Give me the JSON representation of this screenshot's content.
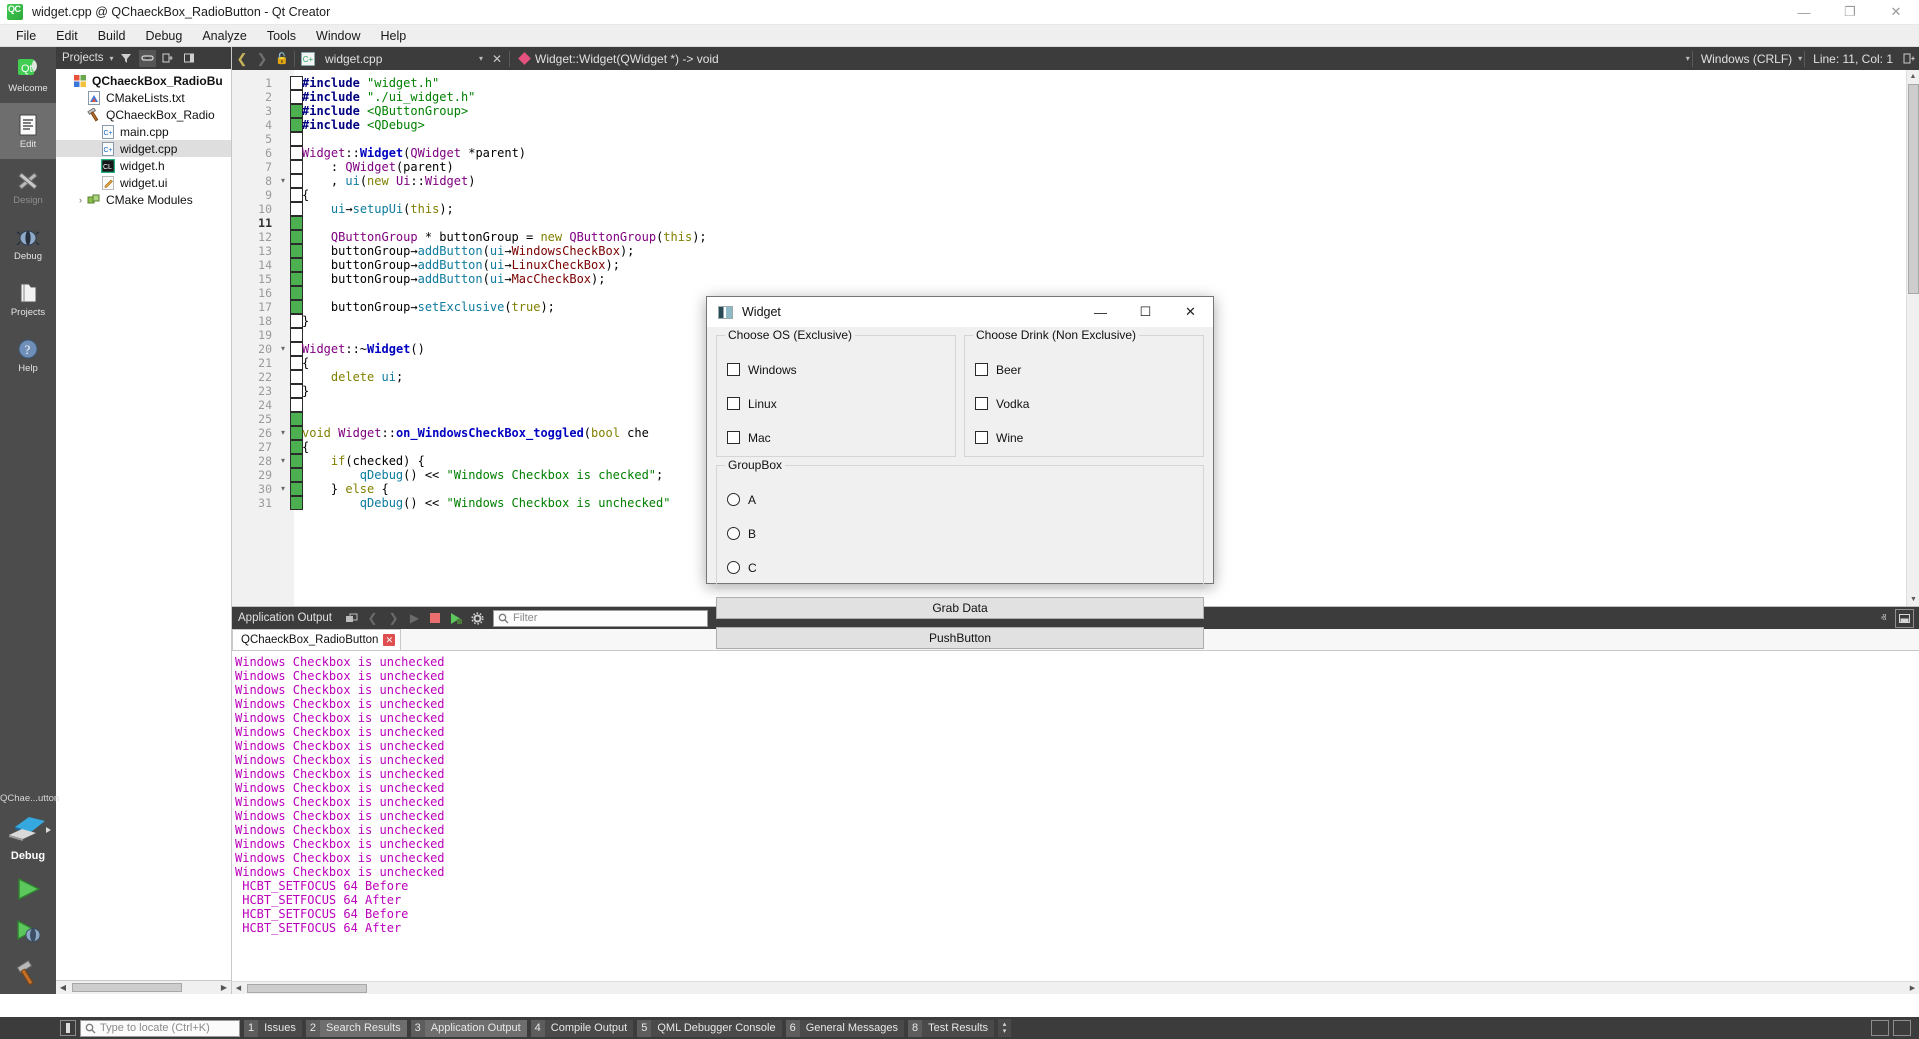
{
  "window": {
    "title": "widget.cpp @ QChaeckBox_RadioButton - Qt Creator",
    "app_icon": "qt-logo-icon",
    "minimize": "—",
    "maximize": "❐",
    "close": "✕"
  },
  "menubar": {
    "items": [
      "File",
      "Edit",
      "Build",
      "Debug",
      "Analyze",
      "Tools",
      "Window",
      "Help"
    ]
  },
  "rail": {
    "modes": [
      {
        "label": "Welcome",
        "icon": "qt-welcome-icon",
        "active": false,
        "disabled": false
      },
      {
        "label": "Edit",
        "icon": "edit-document-icon",
        "active": true,
        "disabled": false
      },
      {
        "label": "Design",
        "icon": "design-ruler-pencil-icon",
        "active": false,
        "disabled": true
      },
      {
        "label": "Debug",
        "icon": "debug-bug-icon",
        "active": false,
        "disabled": false
      },
      {
        "label": "Projects",
        "icon": "projects-folder-icon",
        "active": false,
        "disabled": false
      },
      {
        "label": "Help",
        "icon": "help-question-icon",
        "active": false,
        "disabled": false
      }
    ],
    "kit_name": "QChae...utton",
    "run_config_label": "Debug",
    "buttons": [
      "run-icon",
      "debug-run-icon",
      "build-hammer-icon"
    ]
  },
  "left_dock": {
    "header": {
      "title": "Projects",
      "dropdown_caret": "▾",
      "filter_icon": "filter-icon",
      "link_icon": "link-with-editor-icon",
      "split_icon": "split-icon",
      "close_icon": "close-dock-icon"
    },
    "tree": [
      {
        "level": 0,
        "arrow": "ⱟ",
        "icon": "project-icon",
        "label": "QChaeckBox_RadioBu",
        "bold": true,
        "selected": false
      },
      {
        "level": 1,
        "arrow": "",
        "icon": "cmake-file-icon",
        "label": "CMakeLists.txt",
        "bold": false,
        "selected": false
      },
      {
        "level": 1,
        "arrow": "ⱟ",
        "icon": "hammer-icon",
        "label": "QChaeckBox_Radio",
        "bold": false,
        "selected": false
      },
      {
        "level": 2,
        "arrow": "",
        "icon": "cpp-file-icon",
        "label": "main.cpp",
        "bold": false,
        "selected": false
      },
      {
        "level": 2,
        "arrow": "",
        "icon": "cpp-file-icon",
        "label": "widget.cpp",
        "bold": false,
        "selected": true
      },
      {
        "level": 2,
        "arrow": "",
        "icon": "header-file-icon",
        "label": "widget.h",
        "bold": false,
        "selected": false
      },
      {
        "level": 2,
        "arrow": "",
        "icon": "ui-file-icon",
        "label": "widget.ui",
        "bold": false,
        "selected": false
      },
      {
        "level": 1,
        "arrow": "›",
        "icon": "cmake-modules-icon",
        "label": "CMake Modules",
        "bold": false,
        "selected": false
      }
    ]
  },
  "editor_toolbar": {
    "back_icon": "nav-back-icon",
    "forward_icon": "nav-forward-icon",
    "lock_icon": "unlocked-icon",
    "file_icon": "cpp-file-icon",
    "file_name": "widget.cpp",
    "file_dropdown": "▾",
    "close_file": "✕",
    "symbol_marker": "symbol-diamond-icon",
    "symbol": "Widget::Widget(QWidget *) -> void",
    "symbol_dropdown": "▾",
    "line_ending": "Windows (CRLF)",
    "line_ending_dropdown": "▾",
    "cursor_position": "Line: 11, Col: 1",
    "split_icon": "split-editor-icon"
  },
  "code": {
    "current_line": 11,
    "lines": [
      {
        "n": 1,
        "fold": "",
        "changed": false,
        "html": "<span class='pp'>#include</span> <span class='str'>\"widget.h\"</span>"
      },
      {
        "n": 2,
        "fold": "",
        "changed": false,
        "html": "<span class='pp'>#include</span> <span class='str'>\"./ui_widget.h\"</span>"
      },
      {
        "n": 3,
        "fold": "",
        "changed": true,
        "html": "<span class='pp'>#include</span> <span class='str'>&lt;QButtonGroup&gt;</span>"
      },
      {
        "n": 4,
        "fold": "",
        "changed": true,
        "html": "<span class='pp'>#include</span> <span class='str'>&lt;QDebug&gt;</span>"
      },
      {
        "n": 5,
        "fold": "",
        "changed": false,
        "html": ""
      },
      {
        "n": 6,
        "fold": "",
        "changed": false,
        "html": "<span class='typ'>Widget</span><span class='pl'>::</span><span class='fn'>Widget</span><span class='pl'>(</span><span class='typ'>QWidget</span> <span class='pl'>*parent)</span>"
      },
      {
        "n": 7,
        "fold": "",
        "changed": false,
        "html": "    <span class='pl'>: </span><span class='typ'>QWidget</span><span class='pl'>(parent)</span>"
      },
      {
        "n": 8,
        "fold": "▾",
        "changed": false,
        "html": "    <span class='pl'>, </span><span class='mem'>ui</span><span class='pl'>(</span><span class='kw'>new</span> <span class='typ'>Ui</span><span class='pl'>::</span><span class='typ'>Widget</span><span class='pl'>)</span>"
      },
      {
        "n": 9,
        "fold": "",
        "changed": false,
        "html": "<span class='pl'>{</span>"
      },
      {
        "n": 10,
        "fold": "",
        "changed": false,
        "html": "    <span class='mem'>ui</span><span class='pl'>→</span><span class='mem'>setupUi</span><span class='pl'>(</span><span class='kw'>this</span><span class='pl'>);</span>"
      },
      {
        "n": 11,
        "fold": "",
        "changed": true,
        "html": ""
      },
      {
        "n": 12,
        "fold": "",
        "changed": true,
        "html": "    <span class='typ'>QButtonGroup</span> <span class='pl'>* buttonGroup = </span><span class='kw'>new</span> <span class='typ'>QButtonGroup</span><span class='pl'>(</span><span class='kw'>this</span><span class='pl'>);</span>"
      },
      {
        "n": 13,
        "fold": "",
        "changed": true,
        "html": "    <span class='pl'>buttonGroup→</span><span class='mem'>addButton</span><span class='pl'>(</span><span class='mem'>ui</span><span class='pl'>→</span><span class='var'>WindowsCheckBox</span><span class='pl'>);</span>"
      },
      {
        "n": 14,
        "fold": "",
        "changed": true,
        "html": "    <span class='pl'>buttonGroup→</span><span class='mem'>addButton</span><span class='pl'>(</span><span class='mem'>ui</span><span class='pl'>→</span><span class='var'>LinuxCheckBox</span><span class='pl'>);</span>"
      },
      {
        "n": 15,
        "fold": "",
        "changed": true,
        "html": "    <span class='pl'>buttonGroup→</span><span class='mem'>addButton</span><span class='pl'>(</span><span class='mem'>ui</span><span class='pl'>→</span><span class='var'>MacCheckBox</span><span class='pl'>);</span>"
      },
      {
        "n": 16,
        "fold": "",
        "changed": true,
        "html": ""
      },
      {
        "n": 17,
        "fold": "",
        "changed": true,
        "html": "    <span class='pl'>buttonGroup→</span><span class='mem'>setExclusive</span><span class='pl'>(</span><span class='kw'>true</span><span class='pl'>);</span>"
      },
      {
        "n": 18,
        "fold": "",
        "changed": false,
        "html": "<span class='pl'>}</span>"
      },
      {
        "n": 19,
        "fold": "",
        "changed": false,
        "html": ""
      },
      {
        "n": 20,
        "fold": "▾",
        "changed": false,
        "html": "<span class='typ'>Widget</span><span class='pl'>::~</span><span class='fn'>Widget</span><span class='pl'>()</span>"
      },
      {
        "n": 21,
        "fold": "",
        "changed": false,
        "html": "<span class='pl'>{</span>"
      },
      {
        "n": 22,
        "fold": "",
        "changed": false,
        "html": "    <span class='kw'>delete</span> <span class='mem'>ui</span><span class='pl'>;</span>"
      },
      {
        "n": 23,
        "fold": "",
        "changed": false,
        "html": "<span class='pl'>}</span>"
      },
      {
        "n": 24,
        "fold": "",
        "changed": false,
        "html": ""
      },
      {
        "n": 25,
        "fold": "",
        "changed": true,
        "html": ""
      },
      {
        "n": 26,
        "fold": "▾",
        "changed": true,
        "html": "<span class='kw'>void</span> <span class='typ'>Widget</span><span class='pl'>::</span><span class='fn'>on_WindowsCheckBox_toggled</span><span class='pl'>(</span><span class='kw'>bool</span> <span class='pl'>che</span>"
      },
      {
        "n": 27,
        "fold": "",
        "changed": true,
        "html": "<span class='pl'>{</span>"
      },
      {
        "n": 28,
        "fold": "▾",
        "changed": true,
        "html": "    <span class='kw'>if</span><span class='pl'>(checked) {</span>"
      },
      {
        "n": 29,
        "fold": "",
        "changed": true,
        "html": "        <span class='mem'>qDebug</span><span class='pl'>() &lt;&lt; </span><span class='str'>\"Windows Checkbox is checked\"</span><span class='pl'>;</span>"
      },
      {
        "n": 30,
        "fold": "▾",
        "changed": true,
        "html": "    <span class='pl'>} </span><span class='kw'>else</span> <span class='pl'>{</span>"
      },
      {
        "n": 31,
        "fold": "",
        "changed": true,
        "html": "        <span class='mem'>qDebug</span><span class='pl'>() &lt;&lt; </span><span class='str'>\"Windows Checkbox is unchecked\"</span>"
      }
    ]
  },
  "output_pane": {
    "title": "Application Output",
    "toolbar_icons": [
      "open-in-new-window-icon",
      "prev-item-icon",
      "next-item-icon",
      "run-icon",
      "stop-icon",
      "rerun-icon",
      "settings-gear-icon"
    ],
    "filter_placeholder": "Filter",
    "filter_icon": "search-icon",
    "minimize_icon": "ⱏ",
    "maximize_icon": "maximize-pane-icon",
    "tab": {
      "label": "QChaeckBox_RadioButton",
      "close_badge": "✕"
    },
    "lines": [
      "Windows Checkbox is unchecked",
      "Windows Checkbox is unchecked",
      "Windows Checkbox is unchecked",
      "Windows Checkbox is unchecked",
      "Windows Checkbox is unchecked",
      "Windows Checkbox is unchecked",
      "Windows Checkbox is unchecked",
      "Windows Checkbox is unchecked",
      "Windows Checkbox is unchecked",
      "Windows Checkbox is unchecked",
      "Windows Checkbox is unchecked",
      "Windows Checkbox is unchecked",
      "Windows Checkbox is unchecked",
      "Windows Checkbox is unchecked",
      "Windows Checkbox is unchecked",
      "Windows Checkbox is unchecked",
      " HCBT_SETFOCUS 64 Before",
      " HCBT_SETFOCUS 64 After",
      " HCBT_SETFOCUS 64 Before",
      " HCBT_SETFOCUS 64 After"
    ],
    "text_color": "#bb00bb"
  },
  "statusbar": {
    "sidebar_toggle_icon": "toggle-sidebar-icon",
    "locate_placeholder": "Type to locate (Ctrl+K)",
    "locate_icon": "search-icon",
    "panes": [
      {
        "n": "1",
        "label": "Issues",
        "active": false
      },
      {
        "n": "2",
        "label": "Search Results",
        "active": true
      },
      {
        "n": "3",
        "label": "Application Output",
        "active": true
      },
      {
        "n": "4",
        "label": "Compile Output",
        "active": false
      },
      {
        "n": "5",
        "label": "QML Debugger Console",
        "active": false
      },
      {
        "n": "6",
        "label": "General Messages",
        "active": false
      },
      {
        "n": "8",
        "label": "Test Results",
        "active": false
      }
    ],
    "spinner": {
      "up": "▴",
      "down": "▾"
    },
    "right_buttons": [
      "progress-details-icon",
      "output-toggle-icon"
    ]
  },
  "dialog": {
    "title": "Widget",
    "icon": "widget-app-icon",
    "controls": {
      "minimize": "—",
      "maximize": "☐",
      "close": "✕"
    },
    "groups": [
      {
        "caption": "Choose OS (Exclusive)",
        "control_type": "checkbox",
        "items": [
          {
            "label": "Windows",
            "checked": false
          },
          {
            "label": "Linux",
            "checked": false
          },
          {
            "label": "Mac",
            "checked": false
          }
        ]
      },
      {
        "caption": "Choose Drink (Non Exclusive)",
        "control_type": "checkbox",
        "items": [
          {
            "label": "Beer",
            "checked": false
          },
          {
            "label": "Vodka",
            "checked": false
          },
          {
            "label": "Wine",
            "checked": false
          }
        ]
      }
    ],
    "group_box": {
      "caption": "GroupBox",
      "control_type": "radio",
      "items": [
        {
          "label": "A",
          "checked": false
        },
        {
          "label": "B",
          "checked": false
        },
        {
          "label": "C",
          "checked": false
        }
      ]
    },
    "buttons": [
      {
        "label": "Grab Data"
      },
      {
        "label": "PushButton"
      }
    ]
  }
}
